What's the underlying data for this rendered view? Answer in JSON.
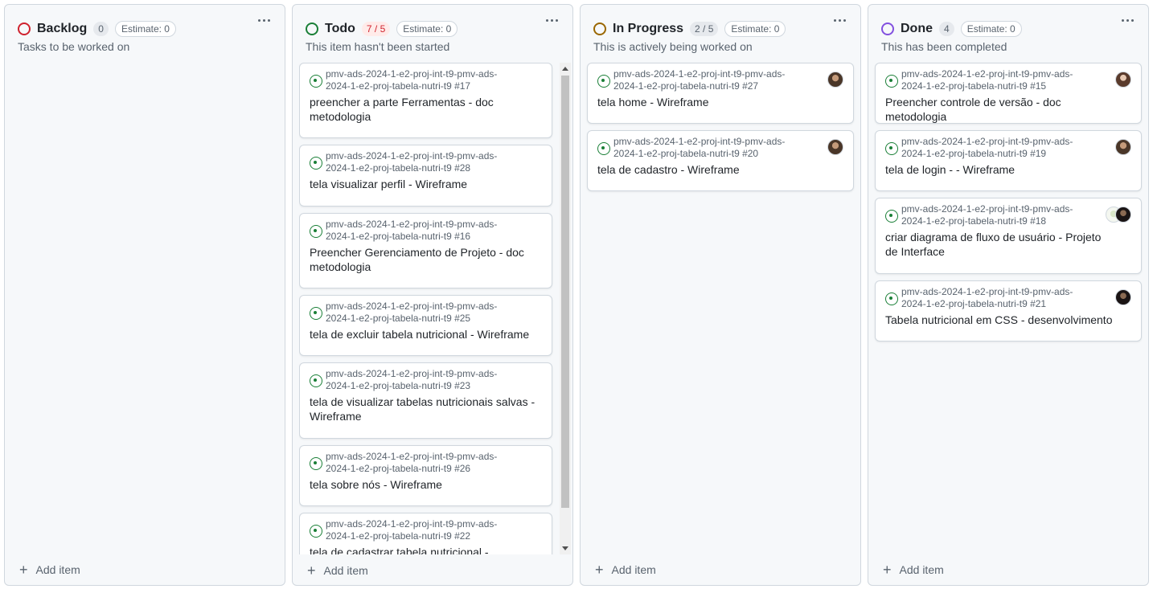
{
  "colors": {
    "backlog": "#cf222e",
    "todo": "#1a7f37",
    "in_progress": "#9a6700",
    "done": "#8250df",
    "issue_open": "#1a7f37"
  },
  "icons": {
    "status": "circle-icon",
    "issue": "issue-opened-icon",
    "menu": "kebab-horizontal-icon",
    "add": "plus-icon"
  },
  "columns": [
    {
      "title": "Backlog",
      "count": "0",
      "estimate": "Estimate: 0",
      "description": "Tasks to be worked on",
      "add_label": "Add item",
      "cards": []
    },
    {
      "title": "Todo",
      "count": "7 / 5",
      "estimate": "Estimate: 0",
      "description": "This item hasn't been started",
      "add_label": "Add item",
      "cards": [
        {
          "repo": "pmv-ads-2024-1-e2-proj-int-t9-pmv-ads-2024-1-e2-proj-tabela-nutri-t9 #17",
          "title": "preencher a parte Ferramentas - doc metodologia"
        },
        {
          "repo": "pmv-ads-2024-1-e2-proj-int-t9-pmv-ads-2024-1-e2-proj-tabela-nutri-t9 #28",
          "title": "tela visualizar perfil - Wireframe"
        },
        {
          "repo": "pmv-ads-2024-1-e2-proj-int-t9-pmv-ads-2024-1-e2-proj-tabela-nutri-t9 #16",
          "title": "Preencher Gerenciamento de Projeto - doc metodologia"
        },
        {
          "repo": "pmv-ads-2024-1-e2-proj-int-t9-pmv-ads-2024-1-e2-proj-tabela-nutri-t9 #25",
          "title": "tela de excluir tabela nutricional - Wireframe"
        },
        {
          "repo": "pmv-ads-2024-1-e2-proj-int-t9-pmv-ads-2024-1-e2-proj-tabela-nutri-t9 #23",
          "title": "tela de visualizar tabelas nutricionais salvas - Wireframe"
        },
        {
          "repo": "pmv-ads-2024-1-e2-proj-int-t9-pmv-ads-2024-1-e2-proj-tabela-nutri-t9 #26",
          "title": "tela sobre nós - Wireframe"
        },
        {
          "repo": "pmv-ads-2024-1-e2-proj-int-t9-pmv-ads-2024-1-e2-proj-tabela-nutri-t9 #22",
          "title": "tela de cadastrar tabela nutricional -"
        }
      ]
    },
    {
      "title": "In Progress",
      "count": "2 / 5",
      "estimate": "Estimate: 0",
      "description": "This is actively being worked on",
      "add_label": "Add item",
      "cards": [
        {
          "repo": "pmv-ads-2024-1-e2-proj-int-t9-pmv-ads-2024-1-e2-proj-tabela-nutri-t9 #27",
          "title": "tela home - Wireframe"
        },
        {
          "repo": "pmv-ads-2024-1-e2-proj-int-t9-pmv-ads-2024-1-e2-proj-tabela-nutri-t9 #20",
          "title": "tela de cadastro - Wireframe"
        }
      ]
    },
    {
      "title": "Done",
      "count": "4",
      "estimate": "Estimate: 0",
      "description": "This has been completed",
      "add_label": "Add item",
      "cards": [
        {
          "repo": "pmv-ads-2024-1-e2-proj-int-t9-pmv-ads-2024-1-e2-proj-tabela-nutri-t9 #15",
          "title": "Preencher controle de versão - doc metodologia"
        },
        {
          "repo": "pmv-ads-2024-1-e2-proj-int-t9-pmv-ads-2024-1-e2-proj-tabela-nutri-t9 #19",
          "title": "tela de login - - Wireframe"
        },
        {
          "repo": "pmv-ads-2024-1-e2-proj-int-t9-pmv-ads-2024-1-e2-proj-tabela-nutri-t9 #18",
          "title": "criar diagrama de fluxo de usuário - Projeto de Interface"
        },
        {
          "repo": "pmv-ads-2024-1-e2-proj-int-t9-pmv-ads-2024-1-e2-proj-tabela-nutri-t9 #21",
          "title": "Tabela nutricional em CSS - desenvolvimento"
        }
      ]
    }
  ]
}
